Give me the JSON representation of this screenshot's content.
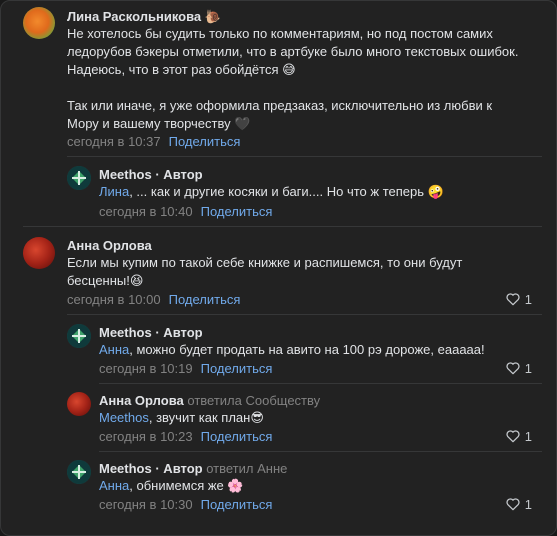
{
  "comments": [
    {
      "author": "Лина Раскольникова",
      "author_emoji": "🐌",
      "lines": [
        "Не хотелось бы судить только по комментариям, но под постом самих",
        "ледорубов бэкеры отметили, что в артбуке было много текстовых ошибок.",
        "Надеюсь, что в этот раз обойдётся 😅",
        "",
        "Так или иначе, я уже оформила предзаказ, исключительно из любви к",
        "Мору и вашему творчеству 🖤"
      ],
      "time": "сегодня в 10:37",
      "share": "Поделиться"
    },
    {
      "author": "Meethos",
      "badge": "· Автор",
      "mention": "Лина",
      "text": ", ... как и другие косяки и баги.... Но что ж теперь 🤪",
      "time": "сегодня в 10:40",
      "share": "Поделиться"
    },
    {
      "author": "Анна Орлова",
      "lines": [
        "Если мы купим по такой себе книжке и распишемся, то они будут",
        "бесценны!😆"
      ],
      "time": "сегодня в 10:00",
      "share": "Поделиться",
      "likes": "1"
    },
    {
      "author": "Meethos",
      "badge": "· Автор",
      "mention": "Анна",
      "text": ", можно будет продать на авито на 100 рэ дороже, еааааа!",
      "time": "сегодня в 10:19",
      "share": "Поделиться",
      "likes": "1"
    },
    {
      "author": "Анна Орлова",
      "replied": "ответила Сообществу",
      "mention": "Meethos",
      "text": ", звучит как план😎",
      "time": "сегодня в 10:23",
      "share": "Поделиться",
      "likes": "1"
    },
    {
      "author": "Meethos",
      "badge": "· Автор",
      "replied": "ответил Анне",
      "mention": "Анна",
      "text": ", обнимемся же 🌸",
      "time": "сегодня в 10:30",
      "share": "Поделиться",
      "likes": "1"
    }
  ],
  "colors": {
    "background": "#222222",
    "link": "#71aaeb",
    "muted": "#828282",
    "text": "#e1e3e6"
  },
  "icons": [
    "heart-icon",
    "avatar-orange-blob",
    "avatar-green-logo",
    "avatar-red-planet"
  ]
}
